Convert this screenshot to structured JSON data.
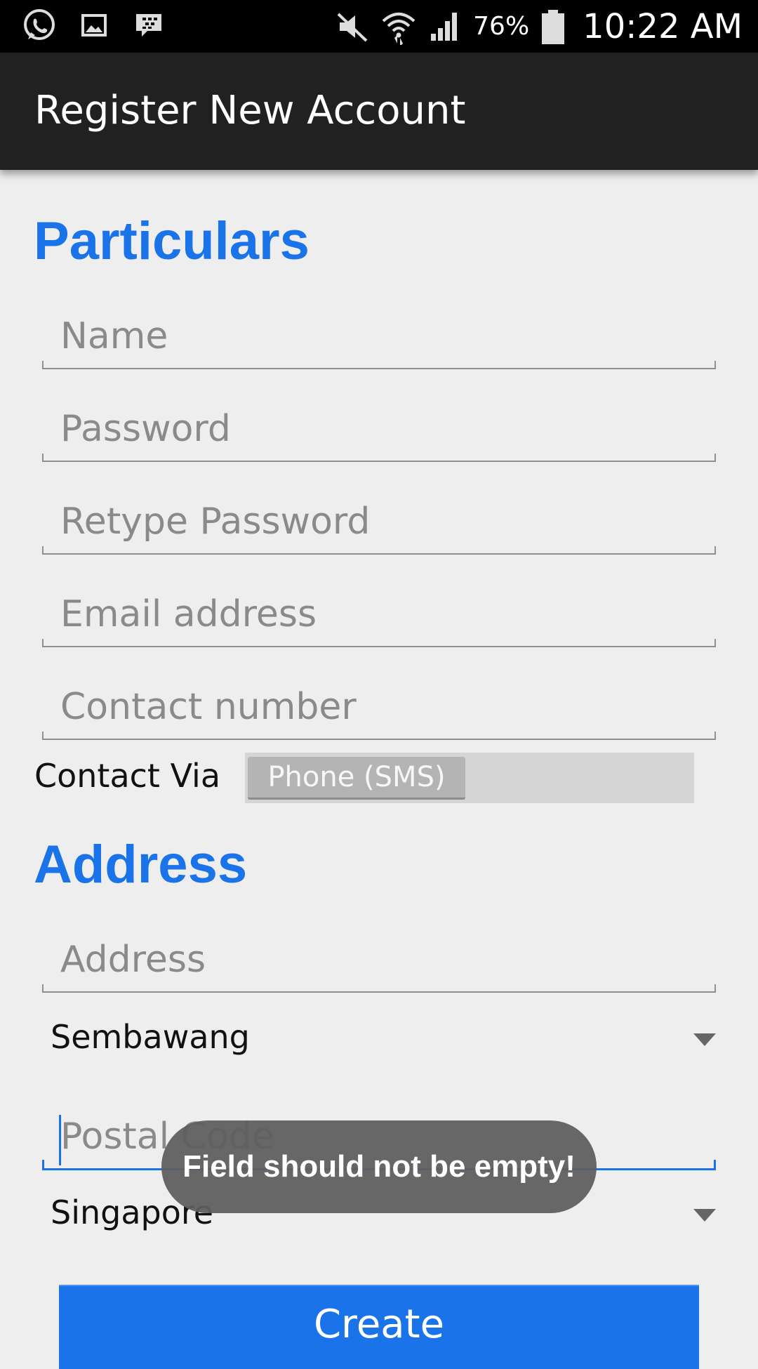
{
  "status_bar": {
    "battery_percent": "76%",
    "time": "10:22 AM",
    "icons": [
      "whatsapp-icon",
      "image-icon",
      "bbm-icon",
      "mute-icon",
      "wifi-icon",
      "signal-icon",
      "battery-icon"
    ]
  },
  "app_bar": {
    "title": "Register New Account"
  },
  "particulars": {
    "heading": "Particulars",
    "name_placeholder": "Name",
    "password_placeholder": "Password",
    "retype_password_placeholder": "Retype Password",
    "email_placeholder": "Email address",
    "contact_placeholder": "Contact number",
    "contact_via_label": "Contact Via",
    "contact_via_value": "Phone (SMS)"
  },
  "address": {
    "heading": "Address",
    "address_placeholder": "Address",
    "area_value": "Sembawang",
    "postal_placeholder": "Postal Code",
    "country_value": "Singapore"
  },
  "toast": {
    "message": "Field should not be empty!"
  },
  "actions": {
    "create_label": "Create"
  },
  "colors": {
    "accent": "#1a73e8",
    "app_bar": "#212121",
    "background": "#eeeeee"
  }
}
